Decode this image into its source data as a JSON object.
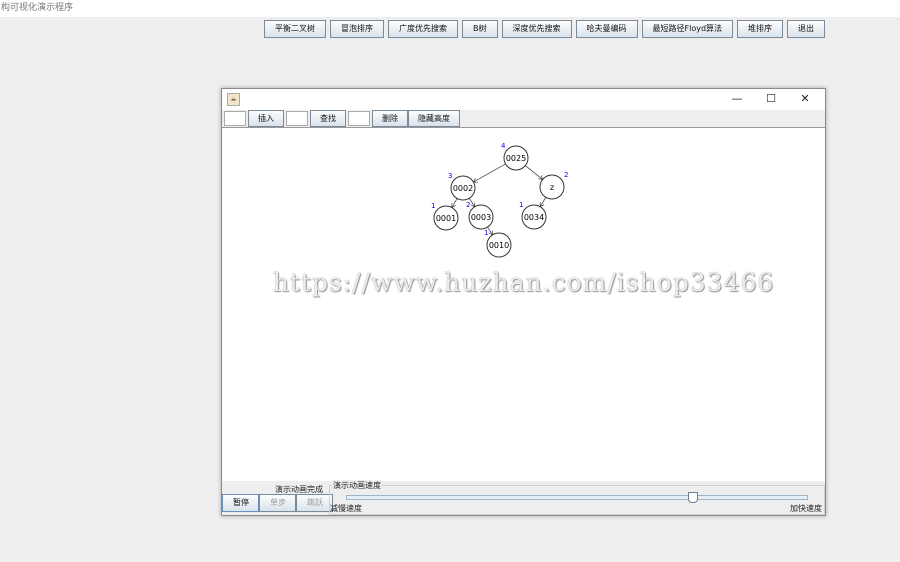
{
  "app_title": "构可视化演示程序",
  "menu": [
    "平衡二叉树",
    "冒泡排序",
    "广度优先搜索",
    "B树",
    "深度优先搜索",
    "哈夫曼编码",
    "最短路径Floyd算法",
    "堆排序",
    "退出"
  ],
  "window": {
    "controls": {
      "minimize": "—",
      "maximize": "☐",
      "close": "✕"
    }
  },
  "toolbar": {
    "insert": "插入",
    "find": "查找",
    "delete": "删除",
    "hide_height": "隐藏高度",
    "insert_value": "",
    "find_value": "",
    "delete_value": ""
  },
  "tree": {
    "nodes": [
      {
        "id": "0025",
        "height": "4"
      },
      {
        "id": "0002",
        "height": "3"
      },
      {
        "id": "z",
        "height": "2"
      },
      {
        "id": "0001",
        "height": "1"
      },
      {
        "id": "0003",
        "height": "2"
      },
      {
        "id": "0034",
        "height": "1"
      },
      {
        "id": "0010",
        "height": "1"
      }
    ],
    "edges": [
      [
        "0025",
        "0002"
      ],
      [
        "0025",
        "z"
      ],
      [
        "0002",
        "0001"
      ],
      [
        "0002",
        "0003"
      ],
      [
        "z",
        "0034"
      ],
      [
        "0003",
        "0010"
      ]
    ]
  },
  "watermark": "https://www.huzhan.com/ishop33466",
  "bottom": {
    "status": "演示动画完成",
    "pause": "暂停",
    "step": "单步",
    "skip": "跳跃",
    "speed_title": "演示动画速度",
    "slower": "减慢速度",
    "faster": "加快速度",
    "speed_fraction": 0.75
  }
}
